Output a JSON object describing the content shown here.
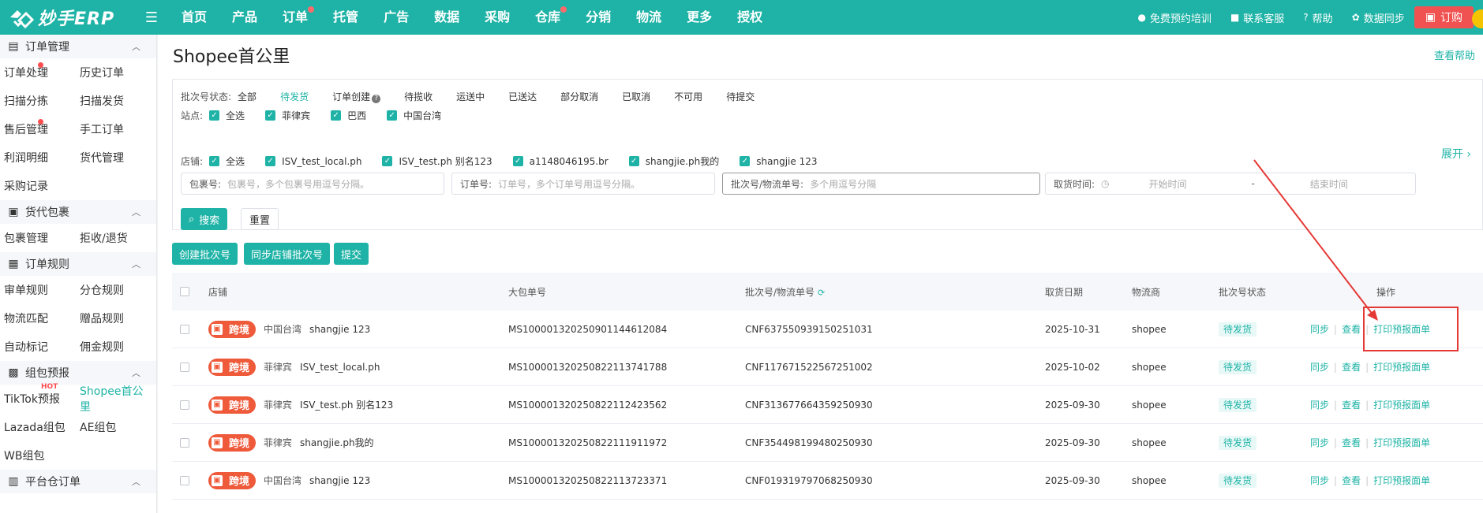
{
  "topbar": {
    "logo_text": "妙手ERP",
    "nav": [
      {
        "label": "首页",
        "dot": false
      },
      {
        "label": "产品",
        "dot": false
      },
      {
        "label": "订单",
        "dot": true
      },
      {
        "label": "托管",
        "dot": false
      },
      {
        "label": "广告",
        "dot": false
      },
      {
        "label": "数据",
        "dot": false
      },
      {
        "label": "采购",
        "dot": false
      },
      {
        "label": "仓库",
        "dot": true
      },
      {
        "label": "分销",
        "dot": false
      },
      {
        "label": "物流",
        "dot": false
      },
      {
        "label": "更多",
        "dot": false
      },
      {
        "label": "授权",
        "dot": false
      }
    ],
    "right": {
      "training": "免费预约培训",
      "support": "联系客服",
      "help": "帮助",
      "sync": "数据同步",
      "buy": "订购"
    }
  },
  "sidebar": {
    "groups": [
      {
        "title": "订单管理",
        "icon": "document-icon",
        "rows": [
          [
            {
              "label": "订单处理",
              "dot": true
            },
            {
              "label": "历史订单"
            }
          ],
          [
            {
              "label": "扫描分拣"
            },
            {
              "label": "扫描发货"
            }
          ],
          [
            {
              "label": "售后管理",
              "dot": true
            },
            {
              "label": "手工订单"
            }
          ],
          [
            {
              "label": "利润明细"
            },
            {
              "label": "货代管理"
            }
          ],
          [
            {
              "label": "采购记录"
            }
          ]
        ]
      },
      {
        "title": "货代包裹",
        "icon": "package-icon",
        "rows": [
          [
            {
              "label": "包裹管理"
            },
            {
              "label": "拒收/退货"
            }
          ]
        ]
      },
      {
        "title": "订单规则",
        "icon": "rules-icon",
        "rows": [
          [
            {
              "label": "审单规则"
            },
            {
              "label": "分仓规则"
            }
          ],
          [
            {
              "label": "物流匹配"
            },
            {
              "label": "赠品规则"
            }
          ],
          [
            {
              "label": "自动标记"
            },
            {
              "label": "佣金规则"
            }
          ]
        ]
      },
      {
        "title": "组包预报",
        "icon": "box-icon",
        "rows": [
          [
            {
              "label": "TikTok预报",
              "hot": "HOT"
            },
            {
              "label": "Shopee首公里",
              "active": true
            }
          ],
          [
            {
              "label": "Lazada组包"
            },
            {
              "label": "AE组包"
            }
          ],
          [
            {
              "label": "WB组包"
            }
          ]
        ]
      },
      {
        "title": "平台仓订单",
        "icon": "warehouse-icon",
        "rows": []
      }
    ]
  },
  "main": {
    "title": "Shopee首公里",
    "help_link": "查看帮助",
    "filters": {
      "status_label": "批次号状态:",
      "status_options": [
        "全部",
        "待发货",
        "订单创建",
        "待揽收",
        "运送中",
        "已送达",
        "部分取消",
        "已取消",
        "不可用",
        "待提交"
      ],
      "status_active_index": 1,
      "status_help_index": 2,
      "site_label": "站点:",
      "sites": [
        "全选",
        "菲律宾",
        "巴西",
        "中国台湾"
      ],
      "store_label": "店铺:",
      "stores": [
        "全选",
        "ISV_test_local.ph",
        "ISV_test.ph 别名123",
        "a1148046195.br",
        "shangjie.ph我的",
        "shangjie 123"
      ],
      "expand": "展开",
      "package_label": "包裹号:",
      "package_placeholder": "包裹号，多个包裹号用逗号分隔。",
      "order_label": "订单号:",
      "order_placeholder": "订单号，多个订单号用逗号分隔。",
      "batch_label": "批次号/物流单号:",
      "batch_placeholder": "多个用逗号分隔",
      "pickup_label": "取货时间:",
      "start_placeholder": "开始时间",
      "range_sep": "-",
      "end_placeholder": "结束时间",
      "search_btn": "搜索",
      "reset_btn": "重置"
    },
    "actions": [
      "创建批次号",
      "同步店铺批次号",
      "提交"
    ],
    "table": {
      "headers": {
        "store": "店铺",
        "bundle": "大包单号",
        "batch": "批次号/物流单号",
        "pickup": "取货日期",
        "carrier": "物流商",
        "status": "批次号状态",
        "ops": "操作"
      },
      "rows": [
        {
          "tag": "跨境",
          "site": "中国台湾",
          "store": "shangjie 123",
          "bundle": "MS10000132025090114461208​4",
          "batch": "CNF637550939150251031",
          "pickup": "2025-10-31",
          "carrier": "shopee",
          "status": "待发货"
        },
        {
          "tag": "跨境",
          "site": "菲律宾",
          "store": "ISV_test_local.ph",
          "bundle": "MS100001320250822113741788",
          "batch": "CNF117671522567251002",
          "pickup": "2025-10-02",
          "carrier": "shopee",
          "status": "待发货"
        },
        {
          "tag": "跨境",
          "site": "菲律宾",
          "store": "ISV_test.ph 别名123",
          "bundle": "MS100001320250822112423562",
          "batch": "CNF313677664359250930",
          "pickup": "2025-09-30",
          "carrier": "shopee",
          "status": "待发货"
        },
        {
          "tag": "跨境",
          "site": "菲律宾",
          "store": "shangjie.ph我的",
          "bundle": "MS100001320250822111911972",
          "batch": "CNF354498199480250930",
          "pickup": "2025-09-30",
          "carrier": "shopee",
          "status": "待发货"
        },
        {
          "tag": "跨境",
          "site": "中国台湾",
          "store": "shangjie 123",
          "bundle": "MS100001320250822113723371",
          "batch": "CNF019319797068250930",
          "pickup": "2025-09-30",
          "carrier": "shopee",
          "status": "待发货"
        }
      ],
      "ops": {
        "sync": "同步",
        "view": "查看",
        "print": "打印预报面单"
      }
    }
  },
  "colors": {
    "primary": "#1eb3a6",
    "danger": "#ee5a3a",
    "annotation": "#e53935"
  }
}
